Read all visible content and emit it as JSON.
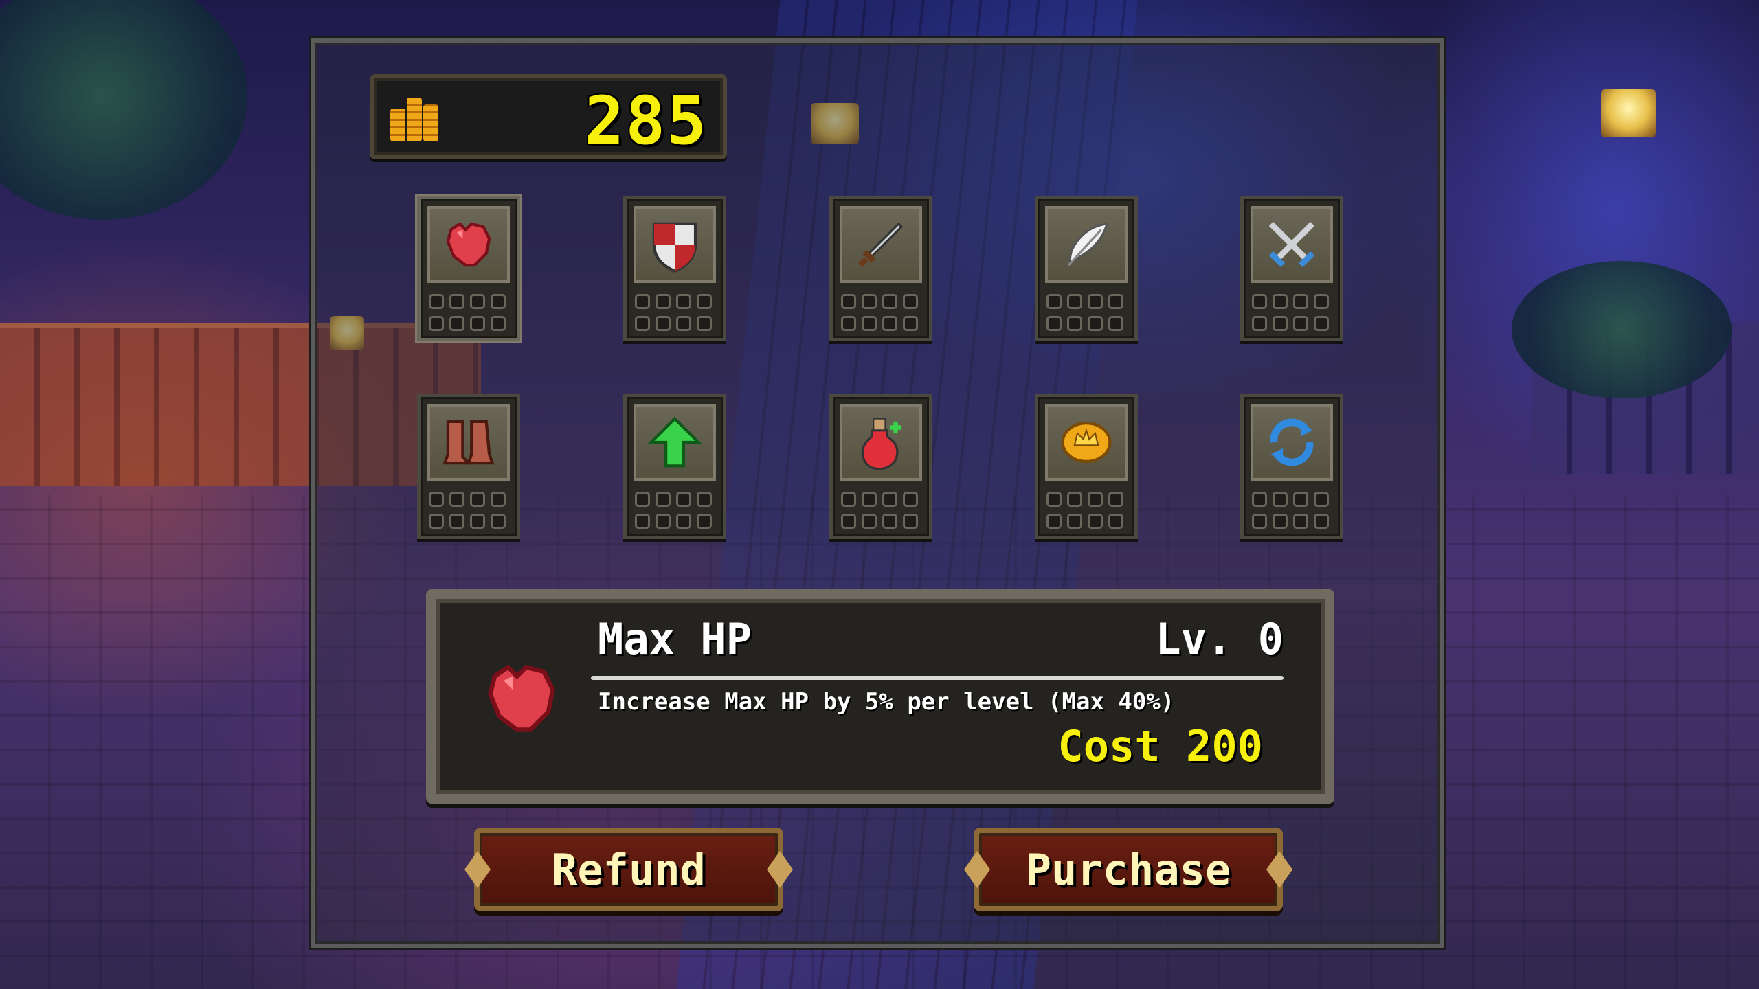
{
  "coins": {
    "count": "285"
  },
  "upgrades": [
    {
      "name": "max-hp",
      "icon": "heart-icon"
    },
    {
      "name": "defense",
      "icon": "shield-icon"
    },
    {
      "name": "attack",
      "icon": "sword-icon"
    },
    {
      "name": "speed",
      "icon": "feather-icon"
    },
    {
      "name": "crossed-swords",
      "icon": "crossed-swords-icon"
    },
    {
      "name": "boots",
      "icon": "boots-icon"
    },
    {
      "name": "level-up",
      "icon": "green-arrow-up-icon"
    },
    {
      "name": "potion",
      "icon": "potion-icon"
    },
    {
      "name": "coin",
      "icon": "gold-coin-icon"
    },
    {
      "name": "refresh",
      "icon": "refresh-icon"
    }
  ],
  "selected": {
    "title": "Max HP",
    "level": "Lv. 0",
    "description": "Increase Max HP by 5% per level (Max 40%)",
    "cost": "Cost 200"
  },
  "buttons": {
    "refund": "Refund",
    "purchase": "Purchase"
  },
  "colors": {
    "accent_yellow": "#f7f00c",
    "button_red": "#5a1a0e",
    "panel_frame": "#6f6b60"
  }
}
